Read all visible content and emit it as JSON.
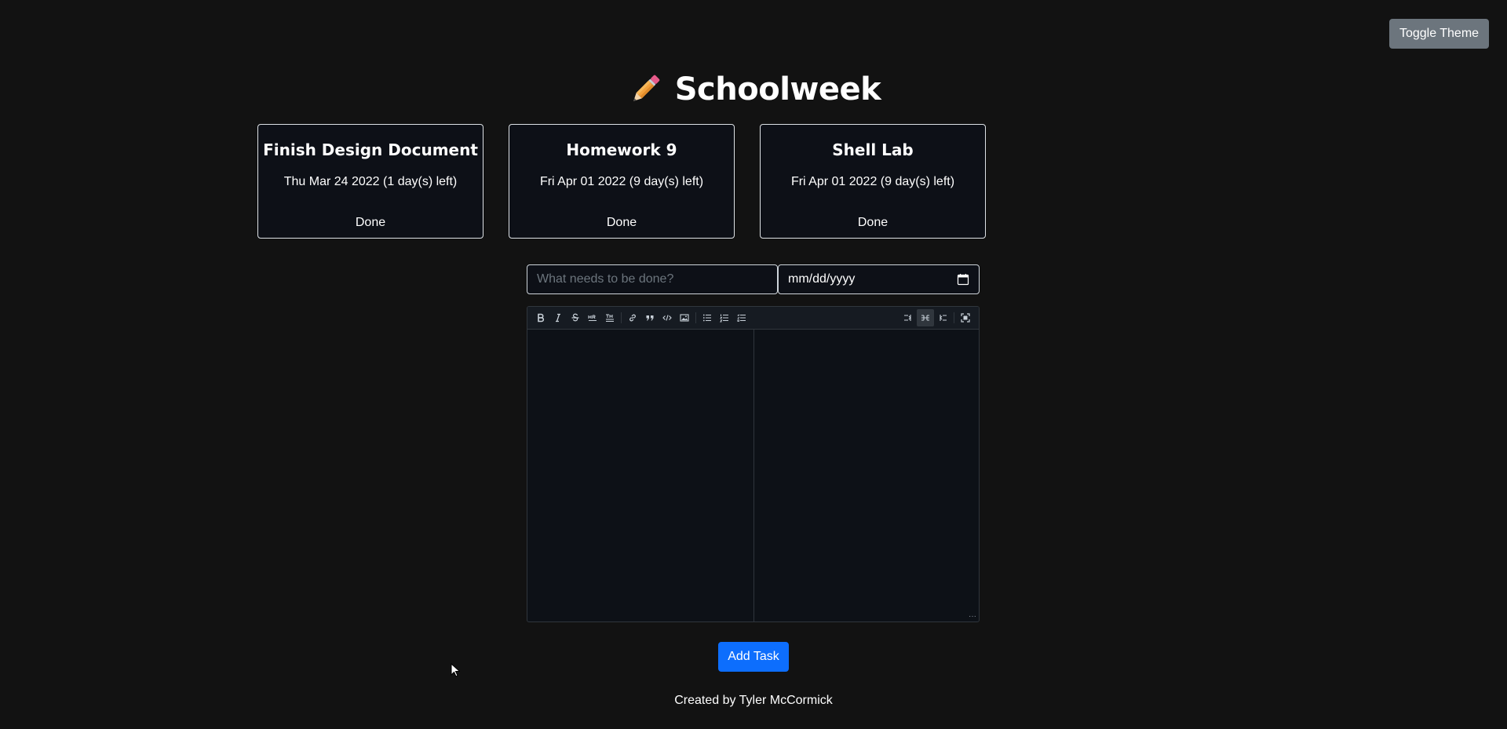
{
  "header": {
    "title": "Schoolweek",
    "logo_icon": "pencil-icon"
  },
  "toggle_theme_label": "Toggle Theme",
  "tasks": [
    {
      "title": "Finish Design Document",
      "due": "Thu Mar 24 2022 (1 day(s) left)",
      "action": "Done"
    },
    {
      "title": "Homework 9",
      "due": "Fri Apr 01 2022 (9 day(s) left)",
      "action": "Done"
    },
    {
      "title": "Shell Lab",
      "due": "Fri Apr 01 2022 (9 day(s) left)",
      "action": "Done"
    }
  ],
  "form": {
    "task_placeholder": "What needs to be done?",
    "date_placeholder": "mm/dd/yyyy",
    "add_label": "Add Task"
  },
  "editor": {
    "toolbar": [
      "bold-icon",
      "italic-icon",
      "strikethrough-icon",
      "horizontal-rule-icon",
      "title-icon",
      "link-icon",
      "quote-icon",
      "code-icon",
      "image-icon",
      "unordered-list-icon",
      "ordered-list-icon",
      "task-list-icon",
      "edit-only-icon",
      "split-view-icon",
      "preview-only-icon",
      "fullscreen-icon"
    ],
    "active_mode": "split-view-icon",
    "resize_handle": "···"
  },
  "footer": "Created by Tyler McCormick",
  "colors": {
    "background": "#121212",
    "card_bg": "#0d1017",
    "primary": "#0d6efd",
    "secondary": "#6c757d"
  }
}
